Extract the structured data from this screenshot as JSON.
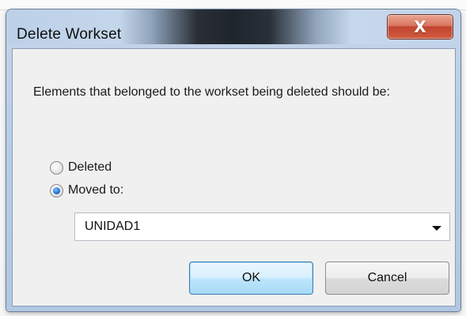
{
  "dialog": {
    "title": "Delete Workset",
    "close_glyph": "X",
    "message": "Elements that belonged to the workset being deleted should be:",
    "options": {
      "deleted_label": "Deleted",
      "moved_label": "Moved to:",
      "selected": "moved"
    },
    "target_workset": "UNIDAD1",
    "buttons": {
      "ok": "OK",
      "cancel": "Cancel"
    }
  }
}
